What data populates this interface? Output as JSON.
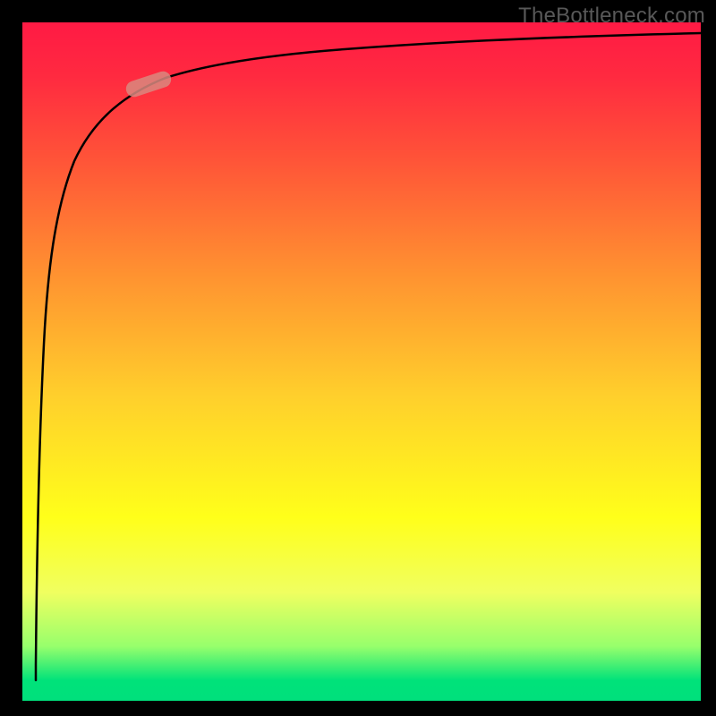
{
  "watermark": "TheBottleneck.com",
  "colors": {
    "black": "#000000",
    "highlight": "#d9887f",
    "gradient_top": "#ff1a44",
    "gradient_mid": "#ffff1a",
    "gradient_bottom": "#00e07c"
  },
  "chart_data": {
    "type": "line",
    "title": "",
    "xlabel": "",
    "ylabel": "",
    "xlim": [
      0,
      100
    ],
    "ylim": [
      0,
      100
    ],
    "grid": false,
    "legend": false,
    "note": "No numeric ticks/labels shown; values below are estimated from pixel positions (x,y in percent of plot area, y=0 bottom).",
    "series": [
      {
        "name": "curve",
        "points": [
          {
            "x": 2.0,
            "y": 3.0
          },
          {
            "x": 2.3,
            "y": 20.0
          },
          {
            "x": 2.8,
            "y": 45.0
          },
          {
            "x": 3.5,
            "y": 62.0
          },
          {
            "x": 5.0,
            "y": 75.0
          },
          {
            "x": 8.0,
            "y": 83.0
          },
          {
            "x": 13.0,
            "y": 88.0
          },
          {
            "x": 20.0,
            "y": 91.0
          },
          {
            "x": 30.0,
            "y": 93.0
          },
          {
            "x": 45.0,
            "y": 95.0
          },
          {
            "x": 65.0,
            "y": 96.5
          },
          {
            "x": 85.0,
            "y": 97.5
          },
          {
            "x": 100.0,
            "y": 98.0
          }
        ]
      }
    ],
    "highlight_segment": {
      "x_start": 15.0,
      "x_end": 21.0,
      "description": "Short red/pink pill marker overlaid on curve near upper-left knee"
    }
  }
}
